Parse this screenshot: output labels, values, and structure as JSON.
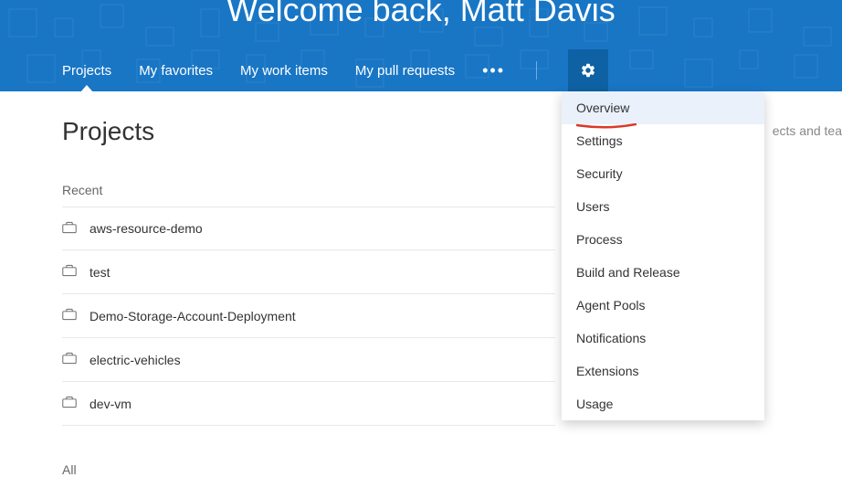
{
  "header": {
    "welcome": "Welcome back, Matt Davis"
  },
  "nav": {
    "items": [
      {
        "label": "Projects",
        "active": true
      },
      {
        "label": "My favorites",
        "active": false
      },
      {
        "label": "My work items",
        "active": false
      },
      {
        "label": "My pull requests",
        "active": false
      }
    ],
    "more": "•••"
  },
  "page": {
    "title": "Projects",
    "recent_label": "Recent",
    "all_label": "All",
    "filter_placeholder": "ects and tea"
  },
  "projects": [
    {
      "name": "aws-resource-demo"
    },
    {
      "name": "test"
    },
    {
      "name": "Demo-Storage-Account-Deployment"
    },
    {
      "name": "electric-vehicles"
    },
    {
      "name": "dev-vm"
    }
  ],
  "settings_menu": [
    {
      "label": "Overview",
      "hover": true,
      "underline": true
    },
    {
      "label": "Settings"
    },
    {
      "label": "Security"
    },
    {
      "label": "Users"
    },
    {
      "label": "Process"
    },
    {
      "label": "Build and Release"
    },
    {
      "label": "Agent Pools"
    },
    {
      "label": "Notifications"
    },
    {
      "label": "Extensions"
    },
    {
      "label": "Usage"
    }
  ]
}
